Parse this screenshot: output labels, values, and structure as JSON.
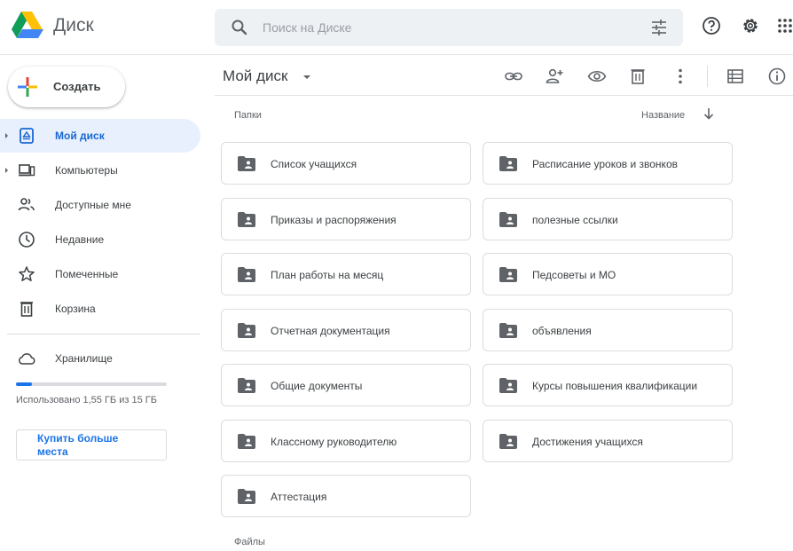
{
  "header": {
    "app_name": "Диск",
    "search_placeholder": "Поиск на Диске",
    "icons": [
      "drive-logo-icon",
      "search-icon",
      "tune-icon",
      "help-icon",
      "gear-icon",
      "apps-grid-icon"
    ]
  },
  "sidebar": {
    "create_label": "Создать",
    "items": [
      {
        "label": "Мой диск",
        "icon": "my-drive-icon",
        "active": true
      },
      {
        "label": "Компьютеры",
        "icon": "computers-icon",
        "active": false
      },
      {
        "label": "Доступные мне",
        "icon": "shared-icon",
        "active": false
      },
      {
        "label": "Недавние",
        "icon": "clock-icon",
        "active": false
      },
      {
        "label": "Помеченные",
        "icon": "star-icon",
        "active": false
      },
      {
        "label": "Корзина",
        "icon": "trash-icon",
        "active": false
      }
    ],
    "storage": {
      "label": "Хранилище",
      "used_text": "Использовано 1,55 ГБ из 15 ГБ",
      "used_fraction": 0.103,
      "buy_label": "Купить больше места"
    }
  },
  "main": {
    "breadcrumb": "Мой диск",
    "toolbar_icons": [
      "link-icon",
      "add-person-icon",
      "eye-icon",
      "trash-icon",
      "more-vert-icon",
      "list-view-icon",
      "info-icon"
    ],
    "folders_label": "Папки",
    "sort_label": "Название",
    "folders": [
      "Список учащихся",
      "Расписание уроков и звонков",
      "Приказы и распоряжения",
      "полезные ссылки",
      "План работы на месяц",
      "Педсоветы и МО",
      "Отчетная документация",
      "объявления",
      "Общие документы",
      "Курсы повышения квалификации",
      "Классному руководителю",
      "Достижения учащихся",
      "Аттестация"
    ],
    "files_label": "Файлы"
  },
  "colors": {
    "accent": "#1a73e8",
    "active_bg": "#e8f0fe",
    "icon": "#5f6368",
    "folder_icon": "#5f6368"
  }
}
